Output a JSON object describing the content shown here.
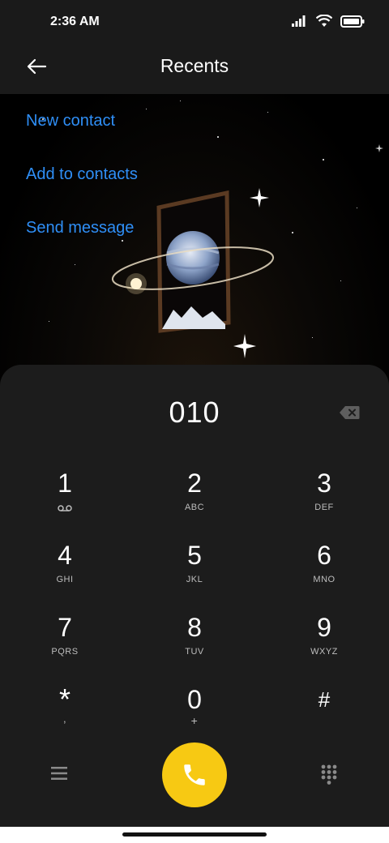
{
  "status": {
    "time": "2:36 AM"
  },
  "header": {
    "title": "Recents"
  },
  "actions": [
    {
      "label": "New contact"
    },
    {
      "label": "Add to contacts"
    },
    {
      "label": "Send message"
    }
  ],
  "dialer": {
    "number": "010",
    "keys": [
      {
        "digit": "1",
        "letters": ""
      },
      {
        "digit": "2",
        "letters": "ABC"
      },
      {
        "digit": "3",
        "letters": "DEF"
      },
      {
        "digit": "4",
        "letters": "GHI"
      },
      {
        "digit": "5",
        "letters": "JKL"
      },
      {
        "digit": "6",
        "letters": "MNO"
      },
      {
        "digit": "7",
        "letters": "PQRS"
      },
      {
        "digit": "8",
        "letters": "TUV"
      },
      {
        "digit": "9",
        "letters": "WXYZ"
      },
      {
        "digit": "*",
        "letters": ","
      },
      {
        "digit": "0",
        "letters": "+"
      },
      {
        "digit": "#",
        "letters": ""
      }
    ]
  },
  "colors": {
    "accent": "#2f8ff7",
    "call": "#f7c913",
    "panel": "#1c1c1c"
  },
  "icons": [
    "signal-icon",
    "wifi-icon",
    "battery-icon",
    "back-arrow-icon",
    "backspace-icon",
    "voicemail-icon",
    "menu-icon",
    "phone-icon",
    "keypad-icon"
  ]
}
